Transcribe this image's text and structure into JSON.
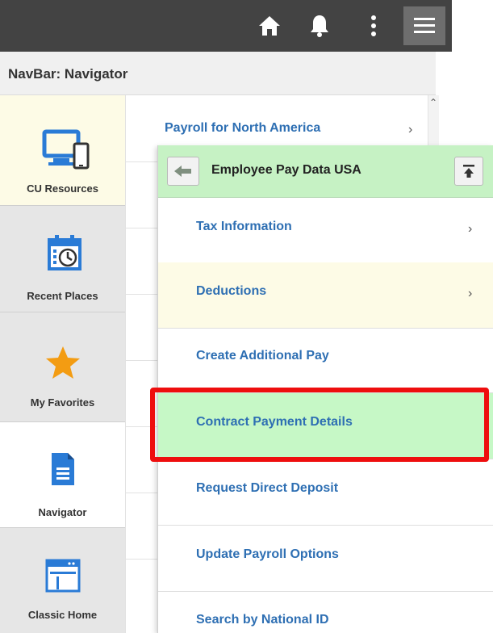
{
  "header": {
    "icons": [
      "home-icon",
      "bell-icon",
      "kebab-icon",
      "hamburger-icon"
    ]
  },
  "navbar": {
    "title": "NavBar: Navigator"
  },
  "tiles": [
    {
      "label": "CU Resources",
      "icon": "devices-icon"
    },
    {
      "label": "Recent Places",
      "icon": "calendar-clock-icon"
    },
    {
      "label": "My Favorites",
      "icon": "star-icon"
    },
    {
      "label": "Navigator",
      "icon": "document-icon"
    },
    {
      "label": "Classic Home",
      "icon": "window-icon"
    }
  ],
  "background_list": {
    "item": "Payroll for North America",
    "chevron": "›"
  },
  "panel": {
    "title": "Employee Pay Data USA",
    "items": [
      {
        "label": "Tax Information",
        "chevron": "›"
      },
      {
        "label": "Deductions",
        "chevron": "›"
      },
      {
        "label": "Create Additional Pay"
      },
      {
        "label": "Contract Payment Details"
      },
      {
        "label": "Request Direct Deposit"
      },
      {
        "label": "Update Payroll Options"
      },
      {
        "label": "Search by National ID"
      }
    ]
  },
  "colors": {
    "topbar": "#434343",
    "link": "#2e6fb3",
    "header_green": "#c6f2c4",
    "selected_green": "#c6f8c6",
    "highlight_yellow": "#fdfbe6",
    "callout_red": "#ee0e0e",
    "favorite_star": "#f39c12",
    "navigator_blue": "#2a7bd6"
  }
}
